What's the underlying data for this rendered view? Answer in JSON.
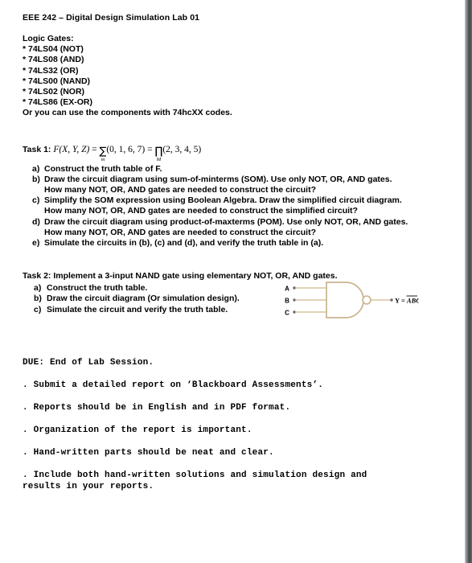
{
  "document": {
    "title": "EEE 242 – Digital Design Simulation Lab 01",
    "logic_gates_label": "Logic Gates:",
    "gates": [
      "* 74LS04 (NOT)",
      "* 74LS08 (AND)",
      "* 74LS32 (OR)",
      "* 74LS00 (NAND)",
      "* 74LS02 (NOR)",
      "* 74LS86 (EX-OR)"
    ],
    "gates_note": "Or you can use the components with 74hcXX codes."
  },
  "task1": {
    "tag": "Task 1:",
    "formula": {
      "function": "F(X, Y, Z)",
      "equals_1": "=",
      "sum_symbol": "∑",
      "sum_subscript": "m",
      "sum_terms": "(0, 1, 6, 7)",
      "equals_2": "=",
      "product_symbol": "∏",
      "product_subscript": "M",
      "product_terms": "(2, 3, 4, 5)"
    },
    "items": [
      {
        "marker": "a)",
        "lines": [
          "Construct the truth table of F."
        ]
      },
      {
        "marker": "b)",
        "lines": [
          "Draw the circuit diagram using sum-of-minterms (SOM). Use only NOT, OR, AND gates.",
          "How many NOT, OR, AND gates are needed to construct the circuit?"
        ]
      },
      {
        "marker": "c)",
        "lines": [
          "Simplify the SOM expression using Boolean Algebra. Draw the simplified circuit diagram.",
          "How many NOT, OR, AND gates are needed to construct the simplified circuit?"
        ]
      },
      {
        "marker": "d)",
        "lines": [
          "Draw the circuit diagram using product-of-maxterms (POM). Use only NOT, OR, AND gates.",
          "How many NOT, OR, AND gates are needed to construct the circuit?"
        ]
      },
      {
        "marker": "e)",
        "lines": [
          "Simulate the circuits in (b), (c) and (d), and verify the truth table in (a)."
        ]
      }
    ]
  },
  "task2": {
    "tag": "Task 2:",
    "heading_text": "Implement a 3-input NAND gate using elementary NOT, OR, AND gates.",
    "items": [
      {
        "marker": "a)",
        "lines": [
          "Construct the truth table."
        ]
      },
      {
        "marker": "b)",
        "lines": [
          "Draw the circuit diagram (Or simulation design)."
        ]
      },
      {
        "marker": "c)",
        "lines": [
          "Simulate the circuit and verify the truth table."
        ]
      }
    ],
    "figure": {
      "inputs": [
        "A",
        "B",
        "C"
      ],
      "output_prefix": "Y = ",
      "output_expression": "ABC",
      "output_overbar": true,
      "wire_color": "#d8c4a0",
      "body_color": "#c9b48c"
    }
  },
  "due": {
    "heading": "DUE: End of Lab Session.",
    "items": [
      ". Submit a detailed report on ‘Blackboard Assessments’.",
      ". Reports should be in English and in PDF format.",
      ". Organization of the report is important.",
      ". Hand-written parts should be neat and clear.",
      ". Include both hand-written solutions and simulation design and results in your reports."
    ]
  }
}
